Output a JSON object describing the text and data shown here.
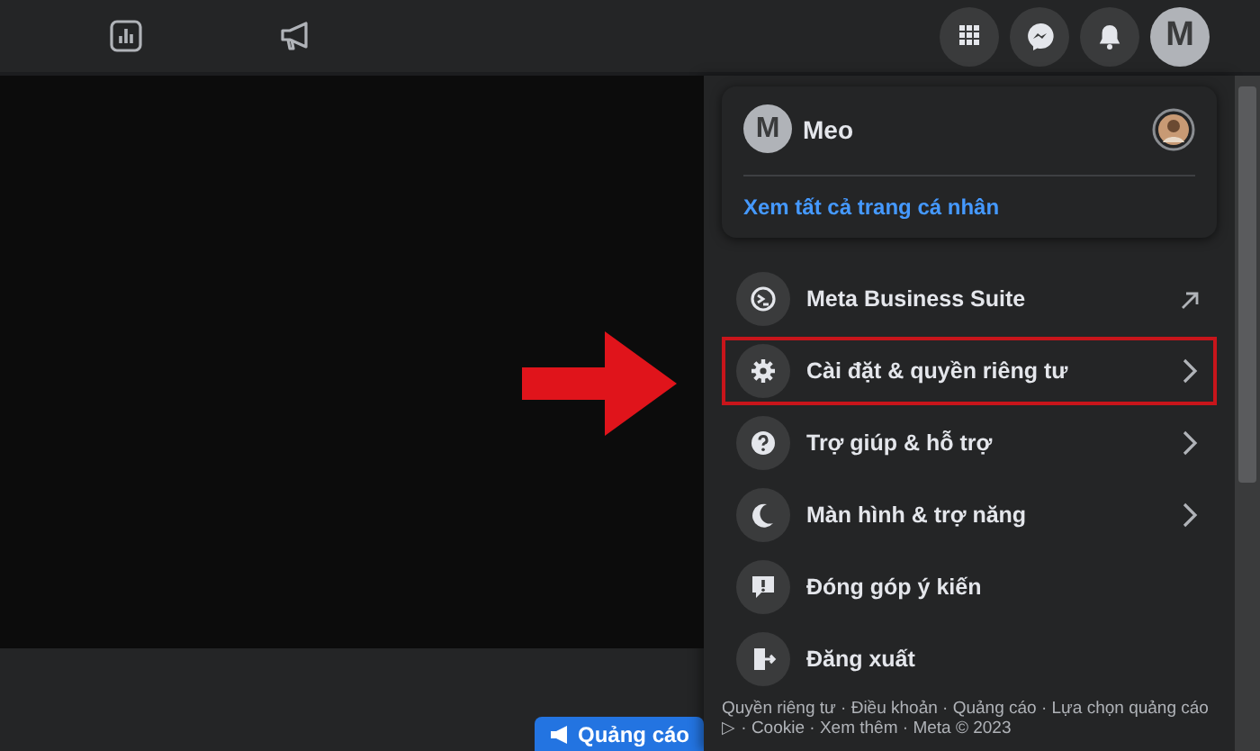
{
  "account_button": {
    "initial": "M"
  },
  "profile_card": {
    "initial": "M",
    "name": "Meo",
    "link": "Xem tất cả trang cá nhân"
  },
  "menu": [
    {
      "label": "Meta Business Suite",
      "kind": "external",
      "highlighted": false
    },
    {
      "label": "Cài đặt & quyền riêng tư",
      "kind": "submenu",
      "highlighted": true
    },
    {
      "label": "Trợ giúp & hỗ trợ",
      "kind": "submenu",
      "highlighted": false
    },
    {
      "label": "Màn hình & trợ năng",
      "kind": "submenu",
      "highlighted": false
    },
    {
      "label": "Đóng góp ý kiến",
      "kind": "action",
      "highlighted": false
    },
    {
      "label": "Đăng xuất",
      "kind": "action",
      "highlighted": false
    }
  ],
  "footer": "Quyền riêng tư · Điều khoản · Quảng cáo · Lựa chọn quảng cáo ▷ · Cookie · Xem thêm · Meta © 2023",
  "ad_button": {
    "label": "Quảng cáo"
  }
}
